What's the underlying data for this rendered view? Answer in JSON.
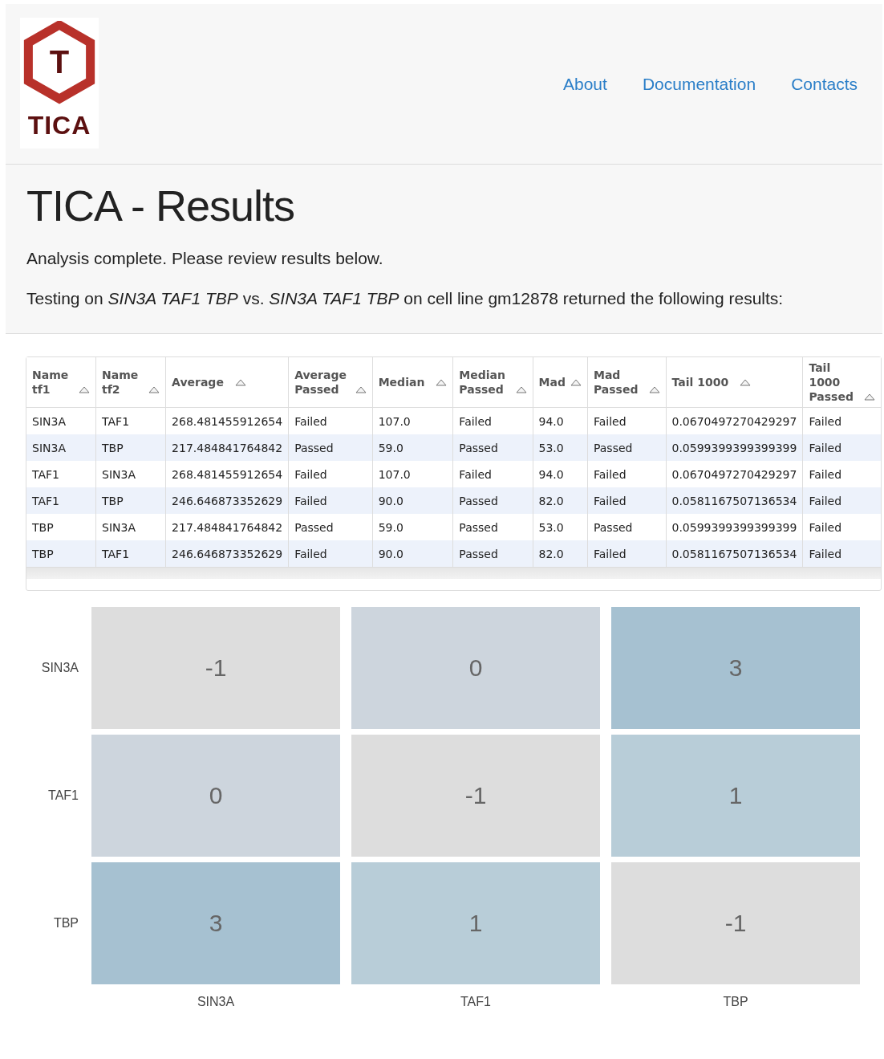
{
  "navbar": {
    "logo_text": "TICA",
    "logo_letter": "T",
    "links": [
      "About",
      "Documentation",
      "Contacts"
    ]
  },
  "header": {
    "title": "TICA - Results",
    "message": "Analysis complete. Please review results below.",
    "description": "Testing on *SIN3A TAF1 TBP* vs. *SIN3A TAF1 TBP* on cell line gm12878 returned the following results:"
  },
  "table": {
    "columns": [
      "Name tf1",
      "Name tf2",
      "Average",
      "Average Passed",
      "Median",
      "Median Passed",
      "Mad",
      "Mad Passed",
      "Tail 1000",
      "Tail 1000 Passed"
    ],
    "rows": [
      [
        "SIN3A",
        "TAF1",
        "268.481455912654",
        "Failed",
        "107.0",
        "Failed",
        "94.0",
        "Failed",
        "0.0670497270429297",
        "Failed"
      ],
      [
        "SIN3A",
        "TBP",
        "217.484841764842",
        "Passed",
        "59.0",
        "Passed",
        "53.0",
        "Passed",
        "0.0599399399399399",
        "Failed"
      ],
      [
        "TAF1",
        "SIN3A",
        "268.481455912654",
        "Failed",
        "107.0",
        "Failed",
        "94.0",
        "Failed",
        "0.0670497270429297",
        "Failed"
      ],
      [
        "TAF1",
        "TBP",
        "246.646873352629",
        "Failed",
        "90.0",
        "Passed",
        "82.0",
        "Failed",
        "0.0581167507136534",
        "Failed"
      ],
      [
        "TBP",
        "SIN3A",
        "217.484841764842",
        "Passed",
        "59.0",
        "Passed",
        "53.0",
        "Passed",
        "0.0599399399399399",
        "Failed"
      ],
      [
        "TBP",
        "TAF1",
        "246.646873352629",
        "Failed",
        "90.0",
        "Passed",
        "82.0",
        "Failed",
        "0.0581167507136534",
        "Failed"
      ]
    ]
  },
  "heatmap": {
    "row_labels": [
      "SIN3A",
      "TAF1",
      "TBP"
    ],
    "column_labels": [
      "SIN3A",
      "TAF1",
      "TBP"
    ],
    "cells": [
      [
        "-1",
        "0",
        "3"
      ],
      [
        "0",
        "-1",
        "1"
      ],
      [
        "3",
        "1",
        "-1"
      ]
    ]
  }
}
